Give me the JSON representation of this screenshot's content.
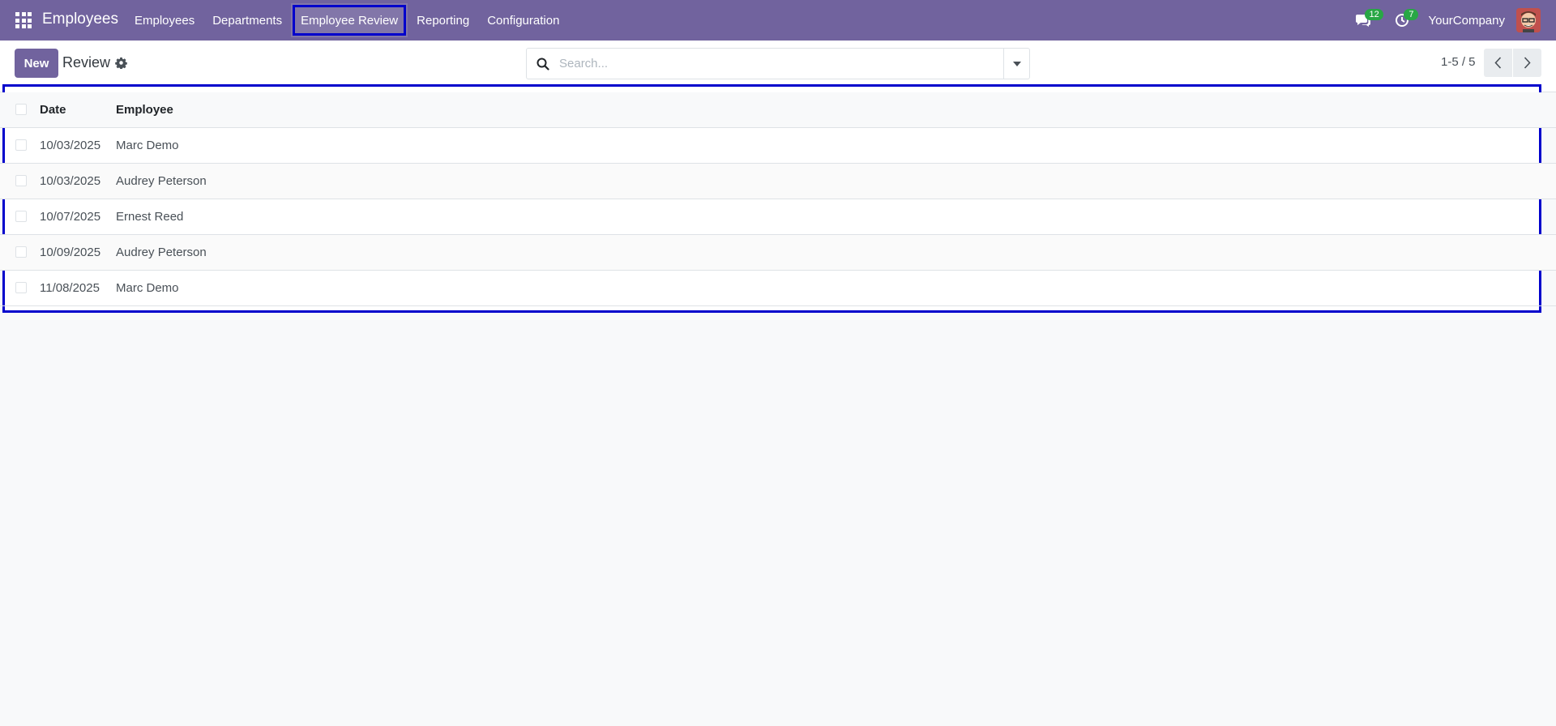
{
  "navbar": {
    "brand": "Employees",
    "menu": [
      {
        "label": "Employees"
      },
      {
        "label": "Departments"
      },
      {
        "label": "Employee Review"
      },
      {
        "label": "Reporting"
      },
      {
        "label": "Configuration"
      }
    ],
    "messages_count": "12",
    "activities_count": "7",
    "company": "YourCompany",
    "colors": {
      "navbar": "#71639e",
      "badge": "#28a745",
      "highlight": "#0000cc"
    }
  },
  "control_panel": {
    "new_label": "New",
    "breadcrumb": "Review",
    "search_placeholder": "Search...",
    "pager_value": "1-5 / 5"
  },
  "list": {
    "columns": [
      "Date",
      "Employee"
    ],
    "rows": [
      {
        "date": "10/03/2025",
        "employee": "Marc Demo"
      },
      {
        "date": "10/03/2025",
        "employee": "Audrey Peterson"
      },
      {
        "date": "10/07/2025",
        "employee": "Ernest Reed"
      },
      {
        "date": "10/09/2025",
        "employee": "Audrey Peterson"
      },
      {
        "date": "11/08/2025",
        "employee": "Marc Demo"
      }
    ]
  },
  "icons": [
    "apps-grid-icon",
    "chat-icon",
    "clock-icon",
    "gear-icon",
    "search-icon",
    "caret-down-icon",
    "chevron-left-icon",
    "chevron-right-icon"
  ]
}
